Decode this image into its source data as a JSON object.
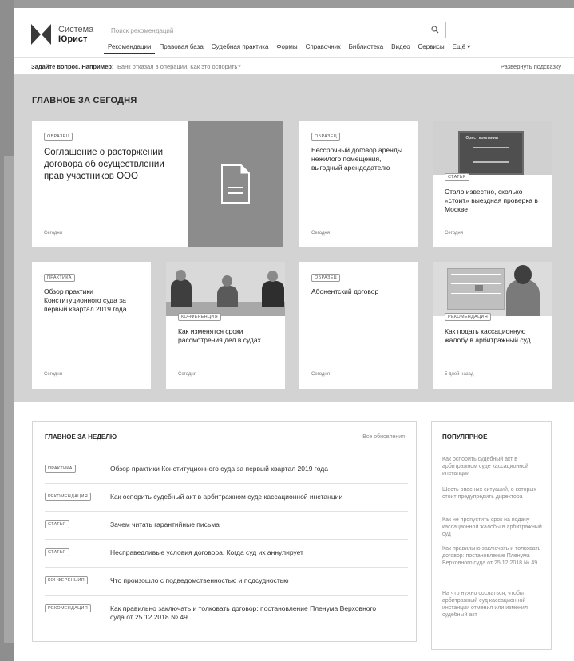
{
  "header": {
    "logo_line1": "Система",
    "logo_line2": "Юрист",
    "search_placeholder": "Поиск рекомендаций",
    "nav": [
      {
        "label": "Рекомендации",
        "active": true
      },
      {
        "label": "Правовая база"
      },
      {
        "label": "Судебная практика"
      },
      {
        "label": "Формы"
      },
      {
        "label": "Справочник"
      },
      {
        "label": "Библиотека"
      },
      {
        "label": "Видео"
      },
      {
        "label": "Сервисы"
      },
      {
        "label": "Ещё ▾"
      }
    ]
  },
  "hint": {
    "label": "Задайте вопрос. Например:",
    "example": "Банк отказал в операции. Как это оспорить?",
    "expand": "Развернуть подсказку"
  },
  "today": {
    "title": "ГЛАВНОЕ ЗА СЕГОДНЯ",
    "cards": [
      {
        "badge": "ОБРАЗЕЦ",
        "title": "Соглашение о расторжении договора об осуществлении прав участников ООО",
        "date": "Сегодня"
      },
      {
        "badge": "ОБРАЗЕЦ",
        "title": "Бессрочный договор аренды нежилого помещения, выгодный арендодателю",
        "date": "Сегодня"
      },
      {
        "badge": "СТАТЬЯ",
        "title": "Стало известно, сколько «стоит» выездная проверка в Москве",
        "date": "Сегодня",
        "book_title": "Юрист компании"
      },
      {
        "badge": "ПРАКТИКА",
        "title": "Обзор практики Конституционного суда за первый квартал 2019 года",
        "date": "Сегодня"
      },
      {
        "badge": "КОНФЕРЕНЦИЯ",
        "title": "Как изменятся сроки рассмотрения дел в судах",
        "date": "Сегодня"
      },
      {
        "badge": "ОБРАЗЕЦ",
        "title": "Абонентский договор",
        "date": "Сегодня"
      },
      {
        "badge": "РЕКОМЕНДАЦИЯ",
        "title": "Как подать кассационную жалобу в арбитражный суд",
        "date": "5 дней назад"
      }
    ]
  },
  "week": {
    "title": "ГЛАВНОЕ ЗА НЕДЕЛЮ",
    "all_link": "Все обновления",
    "rows": [
      {
        "badge": "ПРАКТИКА",
        "text": "Обзор практики Конституционного суда за первый квартал 2019 года"
      },
      {
        "badge": "РЕКОМЕНДАЦИЯ",
        "text": "Как оспорить судебный акт в арбитражном суде кассационной инстанции"
      },
      {
        "badge": "СТАТЬЯ",
        "text": "Зачем читать гарантийные письма"
      },
      {
        "badge": "СТАТЬЯ",
        "text": "Несправедливые условия договора. Когда суд их аннулирует"
      },
      {
        "badge": "КОНФЕРЕНЦИЯ",
        "text": "Что произошло с подведомственностью и подсудностью"
      },
      {
        "badge": "РЕКОМЕНДАЦИЯ",
        "text": "Как правильно заключать и толковать договор: постановление Пленума Верховного суда от 25.12.2018 № 49"
      }
    ]
  },
  "popular": {
    "title": "ПОПУЛЯРНОЕ",
    "items": [
      "Как оспорить судебный акт в арбитражном суде кассационной инстанции",
      "Шесть опасных ситуаций, о которых стоит предупредить директора",
      "Как не пропустить срок на подачу кассационной жалобы в арбитражный суд",
      "Как правильно заключать и толковать договор: постановление Пленума Верховного суда от 25.12.2018 № 49",
      "На что нужно сослаться, чтобы арбитражный суд кассационной инстанции отменил или изменил судебный акт"
    ]
  }
}
